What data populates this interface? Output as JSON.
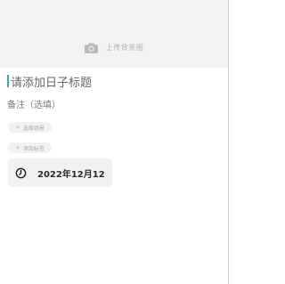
{
  "cover": {
    "upload_label": "上传背景图",
    "icon": "camera-icon"
  },
  "title_input": {
    "placeholder": "请添加日子标题"
  },
  "note_input": {
    "placeholder": "备注（选填）"
  },
  "chips": {
    "scene": {
      "icon": "plus-icon",
      "label": "选择场景"
    },
    "tag": {
      "icon": "plus-icon",
      "label": "添加标签"
    }
  },
  "date": {
    "icon": "clock-icon",
    "value": "2022年12月12"
  },
  "colors": {
    "accent": "#3aa9b1",
    "cover_bg": "#f3f3f3",
    "chip_bg": "#f2f2f2"
  }
}
